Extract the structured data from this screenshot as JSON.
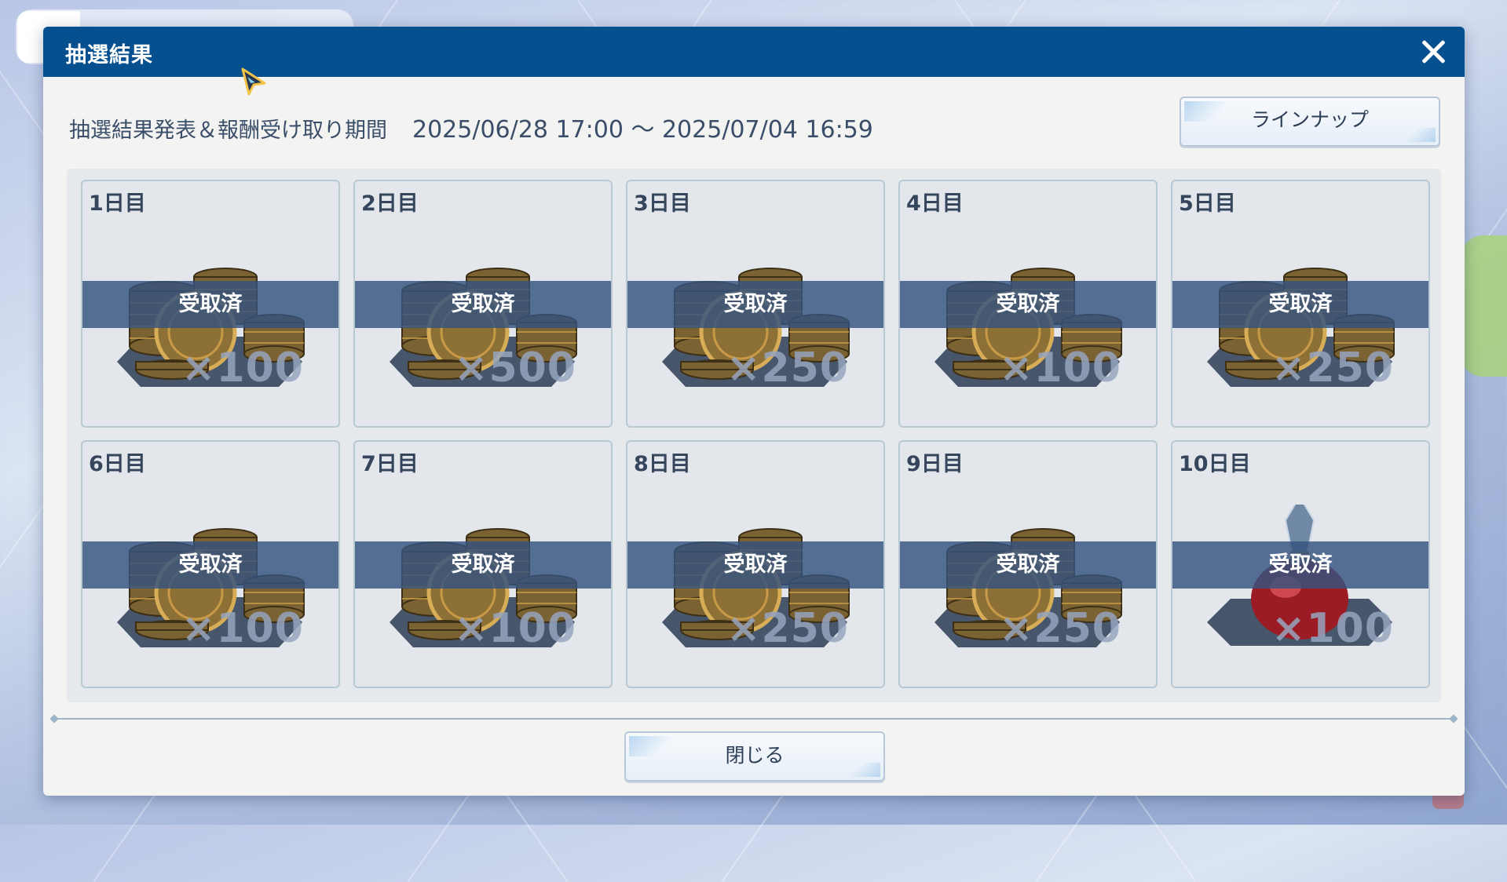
{
  "dialog": {
    "title": "抽選結果",
    "period_label": "抽選結果発表＆報酬受け取り期間",
    "period_range": "2025/06/28 17:00 ～ 2025/07/04 16:59",
    "lineup_button": "ラインナップ",
    "close_button": "閉じる",
    "close_icon": "close-icon"
  },
  "colors": {
    "title_bar": "#06508f",
    "received_band": "#35537f",
    "dialog_bg": "#f3f3f1"
  },
  "rewards": [
    {
      "day": "1日目",
      "item": "coins",
      "quantity": "×100",
      "status": "受取済"
    },
    {
      "day": "2日目",
      "item": "coins",
      "quantity": "×500",
      "status": "受取済"
    },
    {
      "day": "3日目",
      "item": "coins",
      "quantity": "×250",
      "status": "受取済"
    },
    {
      "day": "4日目",
      "item": "coins",
      "quantity": "×100",
      "status": "受取済"
    },
    {
      "day": "5日目",
      "item": "coins",
      "quantity": "×250",
      "status": "受取済"
    },
    {
      "day": "6日目",
      "item": "coins",
      "quantity": "×100",
      "status": "受取済"
    },
    {
      "day": "7日目",
      "item": "coins",
      "quantity": "×100",
      "status": "受取済"
    },
    {
      "day": "8日目",
      "item": "coins",
      "quantity": "×250",
      "status": "受取済"
    },
    {
      "day": "9日目",
      "item": "coins",
      "quantity": "×250",
      "status": "受取済"
    },
    {
      "day": "10日目",
      "item": "potion",
      "quantity": "×100",
      "status": "受取済"
    }
  ]
}
